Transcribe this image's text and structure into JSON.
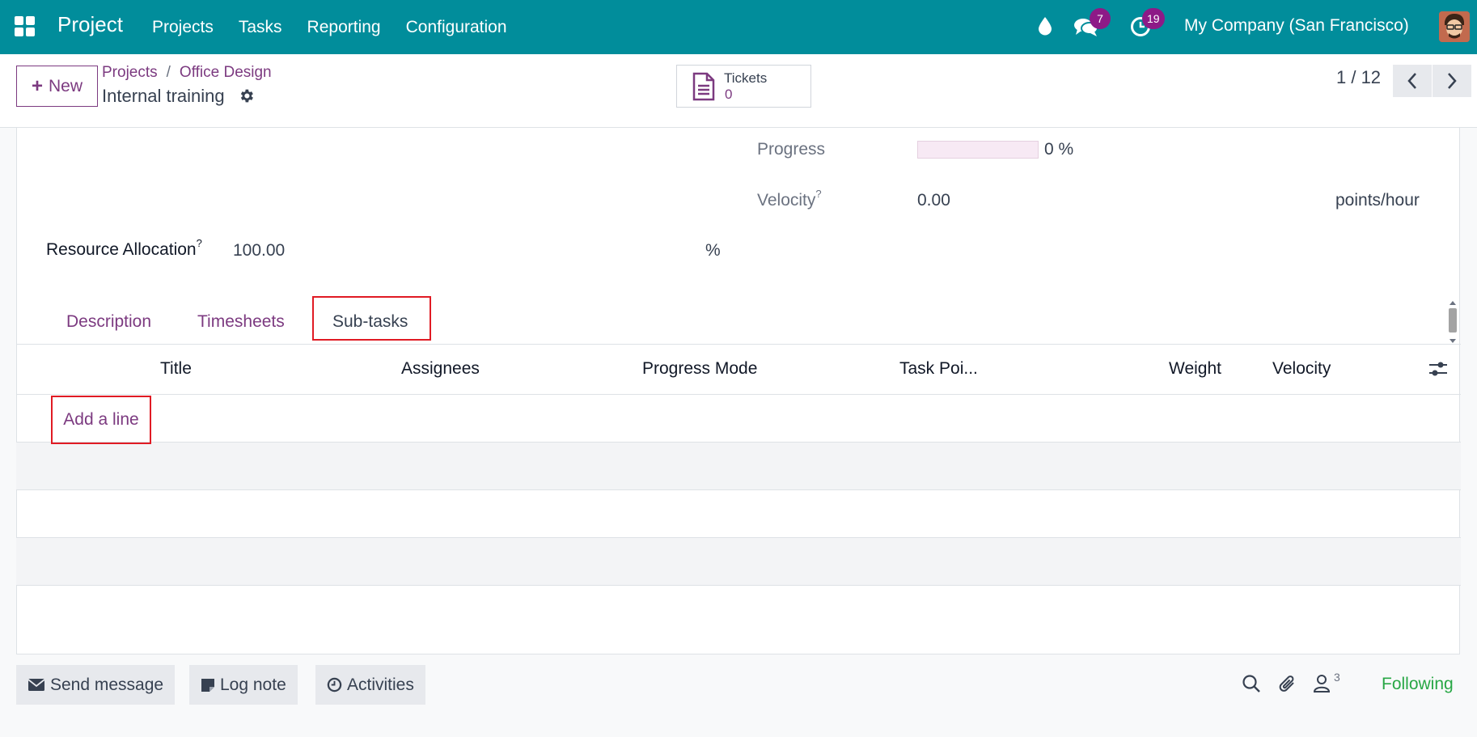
{
  "navbar": {
    "app_name": "Project",
    "menu": [
      "Projects",
      "Tasks",
      "Reporting",
      "Configuration"
    ],
    "messages_badge": "7",
    "activities_badge": "19",
    "company": "My Company (San Francisco)"
  },
  "control_panel": {
    "new_label": "New",
    "breadcrumb": [
      "Projects",
      "Office Design"
    ],
    "breadcrumb_separator": "/",
    "record_title": "Internal training",
    "smart_button": {
      "label": "Tickets",
      "value": "0"
    },
    "pager": "1 / 12"
  },
  "form": {
    "progress": {
      "label": "Progress",
      "value": "0 %",
      "fraction": 0
    },
    "velocity": {
      "label": "Velocity",
      "help": "?",
      "value": "0.00",
      "unit": "points/hour"
    },
    "resource_allocation": {
      "label": "Resource Allocation",
      "help": "?",
      "value": "100.00",
      "unit": "%"
    }
  },
  "tabs": [
    "Description",
    "Timesheets",
    "Sub-tasks"
  ],
  "active_tab": "Sub-tasks",
  "subtasks_table": {
    "columns": [
      "Title",
      "Assignees",
      "Progress Mode",
      "Task Poi...",
      "Weight",
      "Velocity"
    ],
    "add_line_label": "Add a line"
  },
  "chatter": {
    "send_message": "Send message",
    "log_note": "Log note",
    "activities": "Activities",
    "followers_count": "3",
    "following_label": "Following"
  },
  "colors": {
    "navbar": "#018d9b",
    "accent": "#7c3a80",
    "badge": "#8d1a87",
    "highlight": "#e01b24",
    "following": "#28a745"
  }
}
